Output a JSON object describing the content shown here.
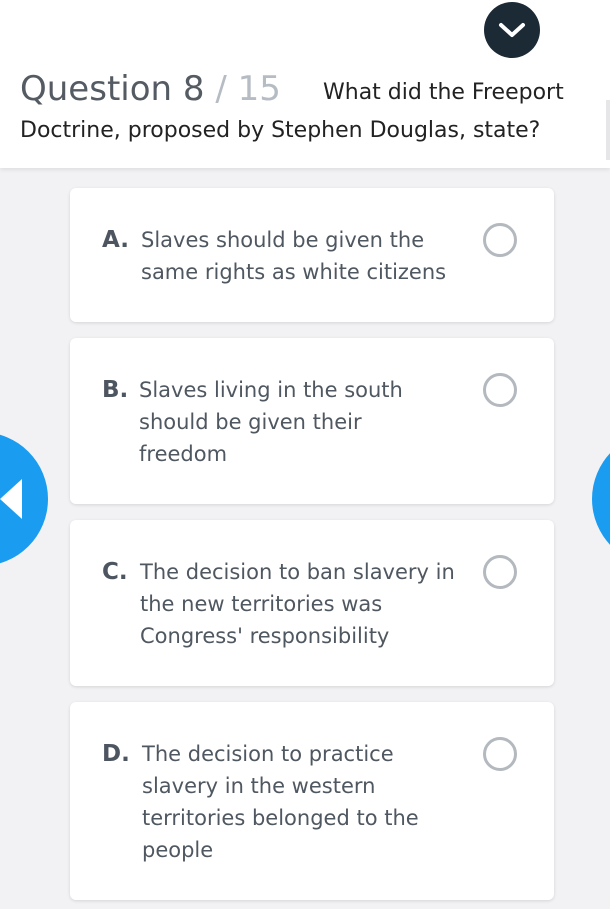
{
  "header": {
    "question_word": "Question",
    "question_number": "8",
    "separator": "/",
    "total_questions": "15",
    "question_text_line1": "What did the Freeport",
    "question_text_line2": "Doctrine, proposed by Stephen Douglas, state?",
    "collapse_icon": "chevron-down-icon"
  },
  "options": [
    {
      "letter": "A.",
      "lines": [
        "Slaves should be given the",
        "same rights as white citizens"
      ]
    },
    {
      "letter": "B.",
      "lines": [
        "Slaves living in the south",
        "should be given their",
        "freedom"
      ]
    },
    {
      "letter": "C.",
      "lines": [
        "The decision to ban slavery in",
        "the new territories was",
        "Congress' responsibility"
      ]
    },
    {
      "letter": "D.",
      "lines": [
        "The decision to practice",
        "slavery in the western",
        "territories belonged to the",
        "people"
      ]
    }
  ],
  "navigation": {
    "prev_icon": "arrow-left-icon",
    "next_icon": "arrow-right-icon"
  },
  "colors": {
    "accent": "#1a9cf0",
    "header_button": "#1c2a36",
    "radio_border": "#b4b9bf"
  }
}
